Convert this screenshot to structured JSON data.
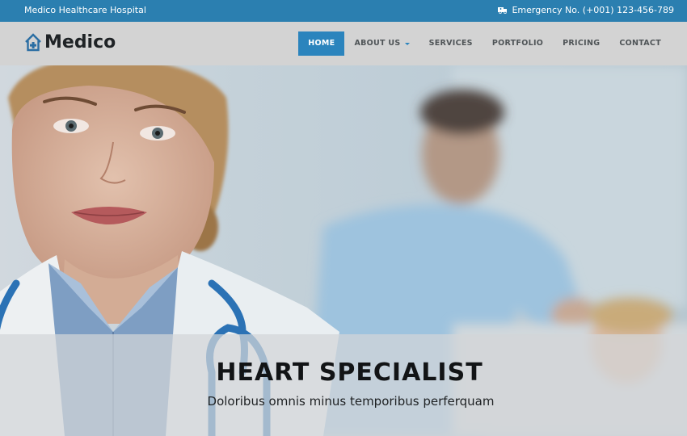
{
  "topbar": {
    "hospital_name": "Medico Healthcare Hospital",
    "emergency": "Emergency No. (+001) 123-456-789",
    "emergency_icon": "ambulance-icon"
  },
  "header": {
    "logo_text": "Medico",
    "logo_icon": "house-plus-icon"
  },
  "nav": {
    "items": [
      {
        "label": "HOME",
        "active": true
      },
      {
        "label": "ABOUT US",
        "active": false,
        "dropdown": true
      },
      {
        "label": "SERVICES",
        "active": false
      },
      {
        "label": "PORTFOLIO",
        "active": false
      },
      {
        "label": "PRICING",
        "active": false
      },
      {
        "label": "CONTACT",
        "active": false
      }
    ]
  },
  "hero": {
    "title": "HEART SPECIALIST",
    "subtitle": "Doloribus omnis minus temporibus perferquam"
  },
  "colors": {
    "topbar": "#2b7fb0",
    "accent": "#2b84bd",
    "navbar": "#d3d3d3"
  }
}
